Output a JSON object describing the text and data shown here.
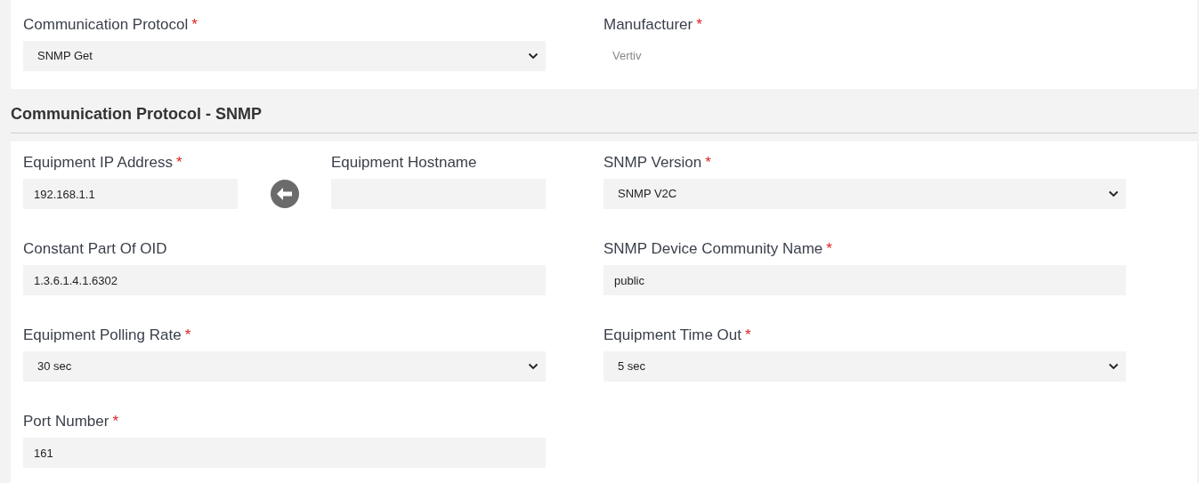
{
  "top_section": {
    "fields": [
      {
        "kind": "select",
        "label": "Communication Protocol",
        "required_mark": "*",
        "value": "SNMP Get"
      },
      {
        "kind": "static",
        "label": "Manufacturer",
        "required_mark": "*",
        "value": "Vertiv"
      }
    ]
  },
  "snmp_section": {
    "title": "Communication Protocol - SNMP",
    "ip_row": {
      "ip": {
        "kind": "text",
        "label": "Equipment IP Address",
        "required_mark": "*",
        "value": "192.168.1.1"
      },
      "hostname": {
        "kind": "text",
        "label": "Equipment Hostname"
      }
    },
    "fields": [
      {
        "kind": "select",
        "label": "SNMP Version",
        "required_mark": "*",
        "value": "SNMP V2C"
      },
      {
        "kind": "text",
        "label": "Constant Part Of OID",
        "value": "1.3.6.1.4.1.6302"
      },
      {
        "kind": "text",
        "label": "SNMP Device Community Name",
        "required_mark": "*",
        "value": "public"
      },
      {
        "kind": "select",
        "label": "Equipment Polling Rate",
        "required_mark": "*",
        "value": "30 sec"
      },
      {
        "kind": "select",
        "label": "Equipment Time Out",
        "required_mark": "*",
        "value": "5 sec"
      },
      {
        "kind": "text",
        "label": "Port Number",
        "required_mark": "*",
        "value": "161"
      }
    ]
  }
}
